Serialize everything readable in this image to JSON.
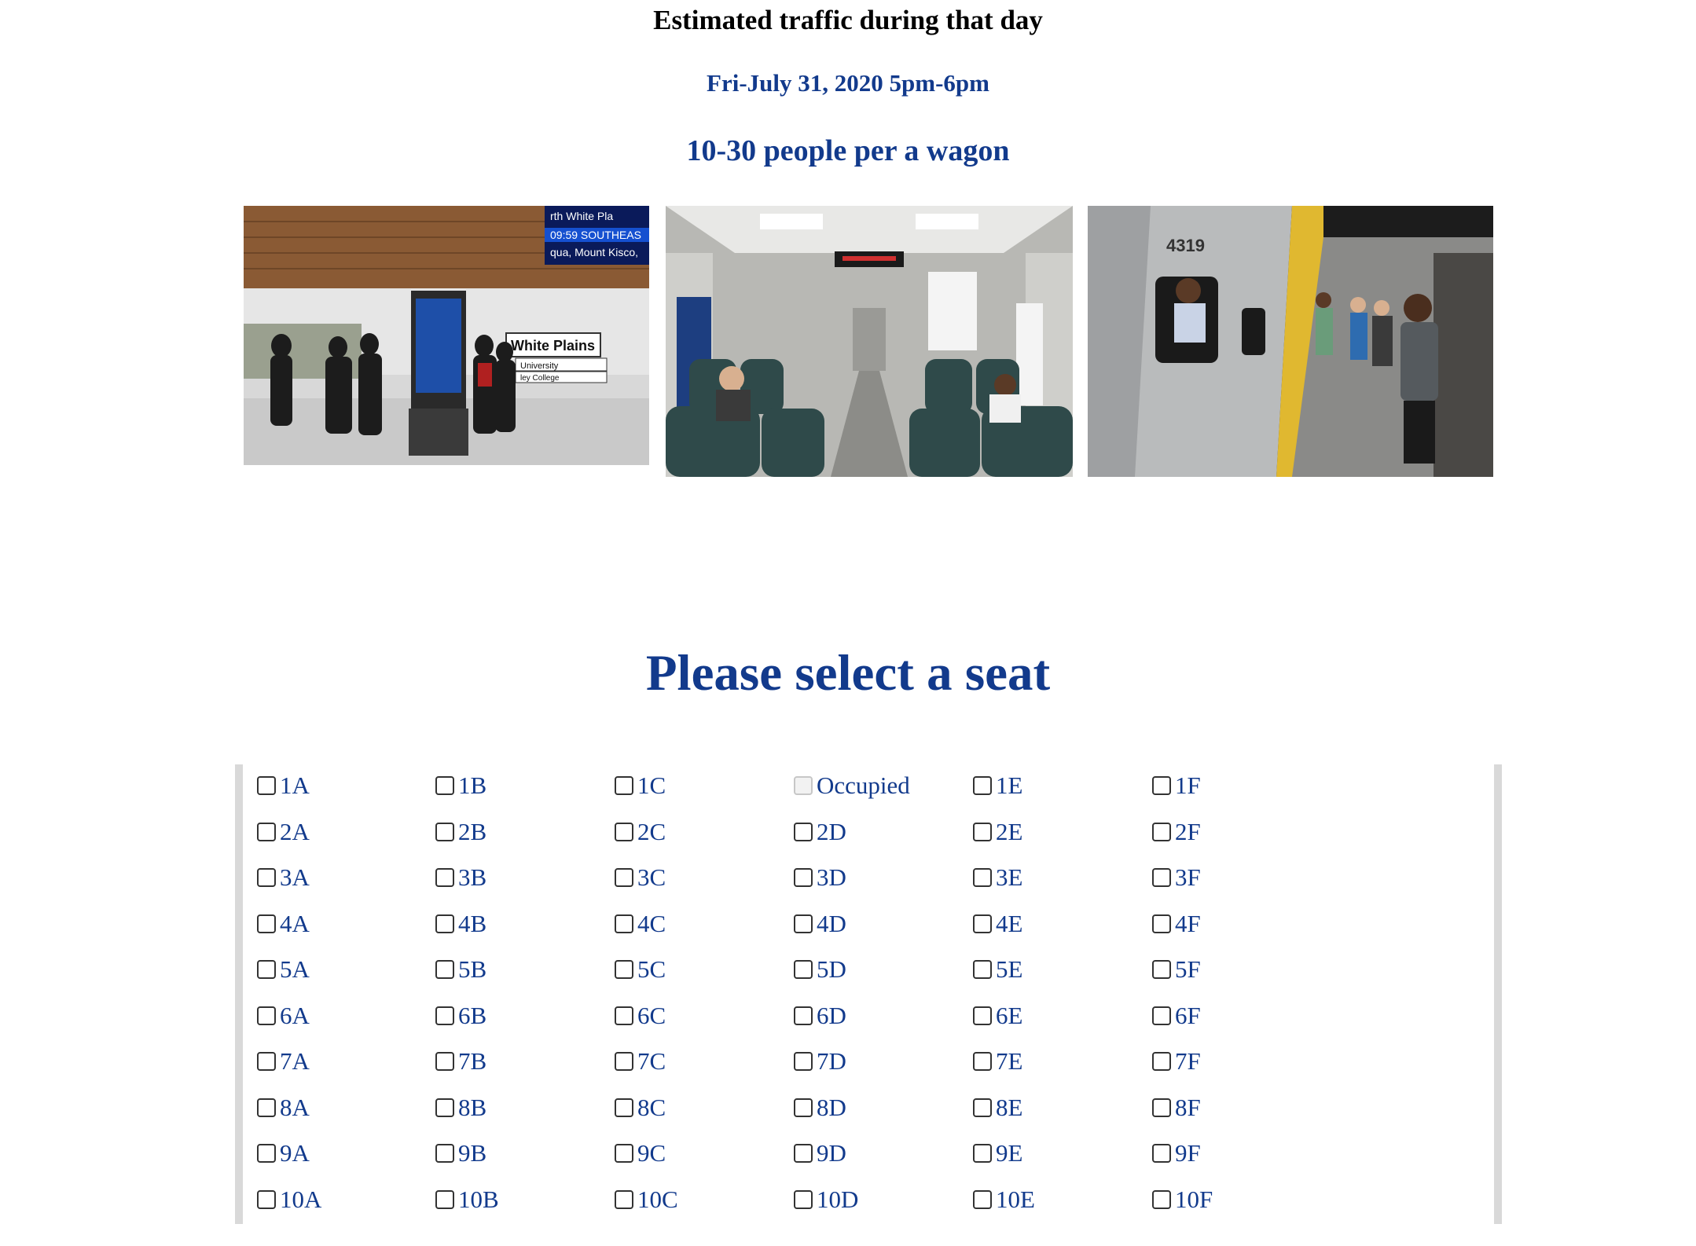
{
  "traffic": {
    "title": "Estimated traffic during that day",
    "date": "Fri-July 31, 2020 5pm-6pm",
    "volume": "10-30 people per a wagon"
  },
  "photos": {
    "platform_sign": "White Plains",
    "platform_sign_sub": "University",
    "platform_sign_sub2": "ley College",
    "platform_board_lines": [
      "rth White Pla",
      "09:59 SOUTHEAS",
      "qua, Mount Kisco,"
    ],
    "train_number": "4319"
  },
  "seat_select": {
    "title": "Please select a seat"
  },
  "seats": [
    [
      {
        "label": "1A",
        "occupied": false
      },
      {
        "label": "1B",
        "occupied": false
      },
      {
        "label": "1C",
        "occupied": false
      },
      {
        "label": "Occupied",
        "occupied": true
      },
      {
        "label": "1E",
        "occupied": false
      },
      {
        "label": "1F",
        "occupied": false
      }
    ],
    [
      {
        "label": "2A",
        "occupied": false
      },
      {
        "label": "2B",
        "occupied": false
      },
      {
        "label": "2C",
        "occupied": false
      },
      {
        "label": "2D",
        "occupied": false
      },
      {
        "label": "2E",
        "occupied": false
      },
      {
        "label": "2F",
        "occupied": false
      }
    ],
    [
      {
        "label": "3A",
        "occupied": false
      },
      {
        "label": "3B",
        "occupied": false
      },
      {
        "label": "3C",
        "occupied": false
      },
      {
        "label": "3D",
        "occupied": false
      },
      {
        "label": "3E",
        "occupied": false
      },
      {
        "label": "3F",
        "occupied": false
      }
    ],
    [
      {
        "label": "4A",
        "occupied": false
      },
      {
        "label": "4B",
        "occupied": false
      },
      {
        "label": "4C",
        "occupied": false
      },
      {
        "label": "4D",
        "occupied": false
      },
      {
        "label": "4E",
        "occupied": false
      },
      {
        "label": "4F",
        "occupied": false
      }
    ],
    [
      {
        "label": "5A",
        "occupied": false
      },
      {
        "label": "5B",
        "occupied": false
      },
      {
        "label": "5C",
        "occupied": false
      },
      {
        "label": "5D",
        "occupied": false
      },
      {
        "label": "5E",
        "occupied": false
      },
      {
        "label": "5F",
        "occupied": false
      }
    ],
    [
      {
        "label": "6A",
        "occupied": false
      },
      {
        "label": "6B",
        "occupied": false
      },
      {
        "label": "6C",
        "occupied": false
      },
      {
        "label": "6D",
        "occupied": false
      },
      {
        "label": "6E",
        "occupied": false
      },
      {
        "label": "6F",
        "occupied": false
      }
    ],
    [
      {
        "label": "7A",
        "occupied": false
      },
      {
        "label": "7B",
        "occupied": false
      },
      {
        "label": "7C",
        "occupied": false
      },
      {
        "label": "7D",
        "occupied": false
      },
      {
        "label": "7E",
        "occupied": false
      },
      {
        "label": "7F",
        "occupied": false
      }
    ],
    [
      {
        "label": "8A",
        "occupied": false
      },
      {
        "label": "8B",
        "occupied": false
      },
      {
        "label": "8C",
        "occupied": false
      },
      {
        "label": "8D",
        "occupied": false
      },
      {
        "label": "8E",
        "occupied": false
      },
      {
        "label": "8F",
        "occupied": false
      }
    ],
    [
      {
        "label": "9A",
        "occupied": false
      },
      {
        "label": "9B",
        "occupied": false
      },
      {
        "label": "9C",
        "occupied": false
      },
      {
        "label": "9D",
        "occupied": false
      },
      {
        "label": "9E",
        "occupied": false
      },
      {
        "label": "9F",
        "occupied": false
      }
    ],
    [
      {
        "label": "10A",
        "occupied": false
      },
      {
        "label": "10B",
        "occupied": false
      },
      {
        "label": "10C",
        "occupied": false
      },
      {
        "label": "10D",
        "occupied": false
      },
      {
        "label": "10E",
        "occupied": false
      },
      {
        "label": "10F",
        "occupied": false
      }
    ]
  ],
  "colors": {
    "heading_blue": "#123a8c",
    "panel_border": "#d9d9d9"
  }
}
